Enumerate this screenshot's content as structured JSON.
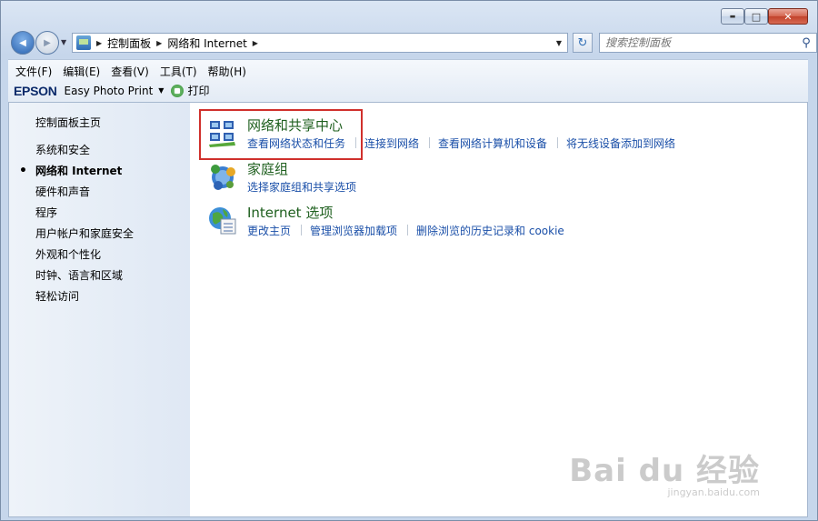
{
  "window": {
    "caption": {
      "minimize": "▬",
      "maximize": "□",
      "close": "✕"
    }
  },
  "nav": {
    "back_glyph": "◀",
    "forward_glyph": "▶",
    "breadcrumb": [
      "控制面板",
      "网络和 Internet"
    ],
    "search_placeholder": "搜索控制面板",
    "refresh_glyph": "↻"
  },
  "menubar": {
    "items": [
      "文件(F)",
      "编辑(E)",
      "查看(V)",
      "工具(T)",
      "帮助(H)"
    ]
  },
  "toolbar": {
    "brand": "EPSON",
    "app": "Easy Photo Print",
    "print": "打印"
  },
  "sidebar": {
    "home": "控制面板主页",
    "items": [
      {
        "label": "系统和安全",
        "active": false
      },
      {
        "label": "网络和 Internet",
        "active": true
      },
      {
        "label": "硬件和声音",
        "active": false
      },
      {
        "label": "程序",
        "active": false
      },
      {
        "label": "用户帐户和家庭安全",
        "active": false
      },
      {
        "label": "外观和个性化",
        "active": false
      },
      {
        "label": "时钟、语言和区域",
        "active": false
      },
      {
        "label": "轻松访问",
        "active": false
      }
    ]
  },
  "categories": [
    {
      "title": "网络和共享中心",
      "icon": "network-sharing-icon",
      "links": [
        "查看网络状态和任务",
        "连接到网络",
        "查看网络计算机和设备",
        "将无线设备添加到网络"
      ]
    },
    {
      "title": "家庭组",
      "icon": "homegroup-icon",
      "links": [
        "选择家庭组和共享选项"
      ]
    },
    {
      "title": "Internet 选项",
      "icon": "internet-options-icon",
      "links": [
        "更改主页",
        "管理浏览器加载项",
        "删除浏览的历史记录和 cookie"
      ]
    }
  ],
  "watermark": {
    "big": "Bai du 经验",
    "small": "jingyan.baidu.com"
  },
  "colors": {
    "highlight": "#d0302c",
    "link": "#1a4fa8",
    "title": "#1e5f1e"
  }
}
